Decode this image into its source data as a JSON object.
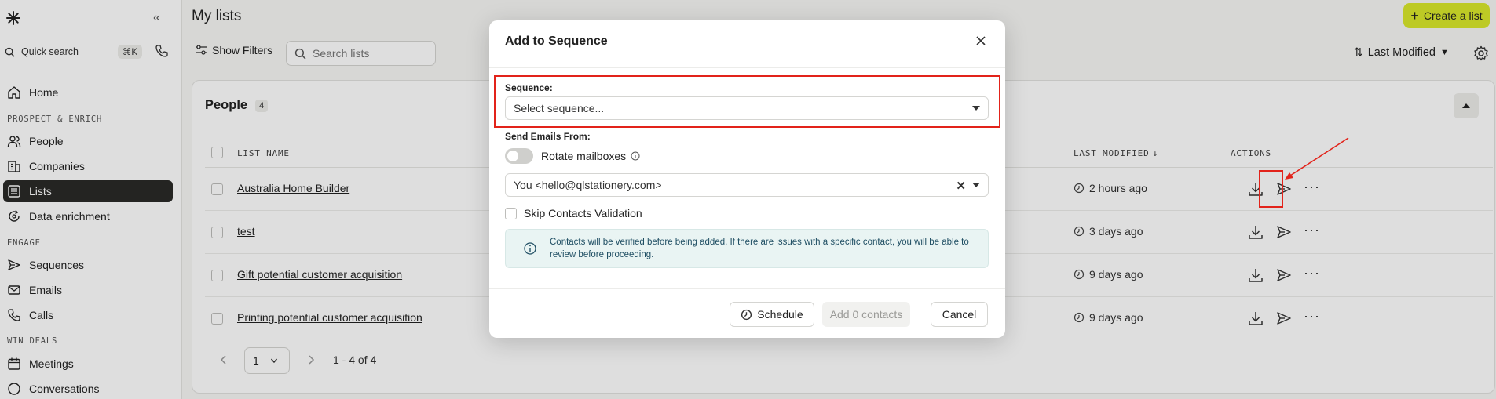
{
  "sidebar": {
    "quick_search": "Quick search",
    "shortcut": "⌘K",
    "items": {
      "home": "Home",
      "people": "People",
      "companies": "Companies",
      "lists": "Lists",
      "data_enrichment": "Data enrichment",
      "sequences": "Sequences",
      "emails": "Emails",
      "calls": "Calls",
      "meetings": "Meetings",
      "conversations": "Conversations"
    },
    "sections": {
      "prospect": "PROSPECT & ENRICH",
      "engage": "ENGAGE",
      "win": "WIN DEALS"
    }
  },
  "header": {
    "title": "My lists",
    "create_label": "Create a list",
    "filters_label": "Show Filters",
    "search_placeholder": "Search lists",
    "sort_label": "Last Modified"
  },
  "card": {
    "title": "People",
    "count": "4",
    "columns": {
      "name": "LIST NAME",
      "modified": "LAST MODIFIED",
      "actions": "ACTIONS"
    },
    "rows": [
      {
        "name": "Australia Home Builder",
        "modified": "2 hours ago"
      },
      {
        "name": "test",
        "modified": "3 days ago"
      },
      {
        "name": "Gift potential customer acquisition",
        "modified": "9 days ago"
      },
      {
        "name": "Printing potential customer acquisition",
        "modified": "9 days ago"
      }
    ],
    "pagination": {
      "page": "1",
      "range": "1 - 4 of 4"
    }
  },
  "modal": {
    "title": "Add to Sequence",
    "sequence_label": "Sequence:",
    "sequence_placeholder": "Select sequence...",
    "send_from_label": "Send Emails From:",
    "rotate_label": "Rotate mailboxes",
    "mailbox_value": "You <hello@qlstationery.com>",
    "skip_label": "Skip Contacts Validation",
    "info_text": "Contacts will be verified before being added. If there are issues with a specific contact, you will be able to review before proceeding.",
    "schedule_label": "Schedule",
    "add_label": "Add 0 contacts",
    "cancel_label": "Cancel"
  },
  "colors": {
    "accent": "#d9e82b",
    "highlight": "#e2231a",
    "info_bg": "#e9f4f3"
  }
}
